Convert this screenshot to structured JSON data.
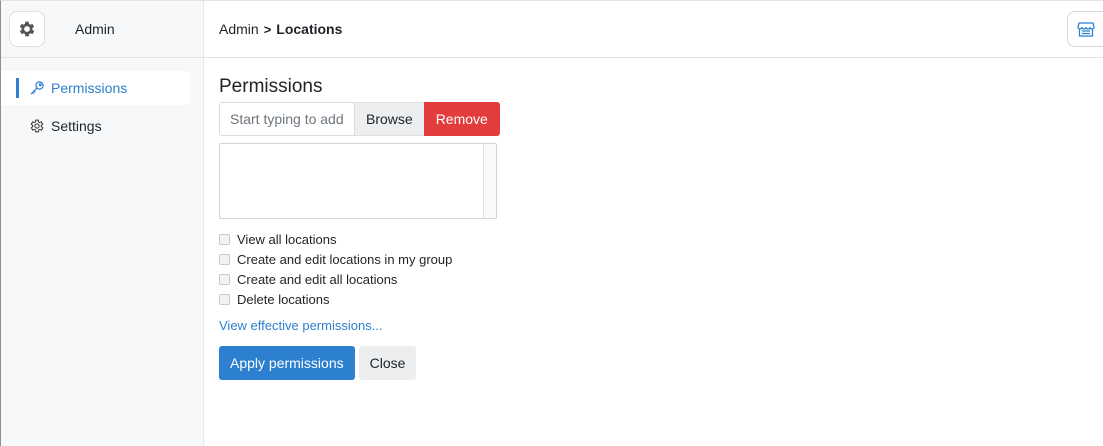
{
  "sidebar": {
    "title": "Admin",
    "logo_icon": "gear-icon",
    "items": [
      {
        "label": "Permissions",
        "icon": "key-icon",
        "active": true
      },
      {
        "label": "Settings",
        "icon": "gear-icon",
        "active": false
      }
    ]
  },
  "breadcrumb": {
    "parent": "Admin",
    "separator": ">",
    "current": "Locations"
  },
  "topbar": {
    "store_icon": "store-icon"
  },
  "permissions": {
    "title": "Permissions",
    "input_placeholder": "Start typing to add",
    "browse_label": "Browse",
    "remove_label": "Remove",
    "checkboxes": [
      {
        "label": "View all locations",
        "checked": false
      },
      {
        "label": "Create and edit locations in my group",
        "checked": false
      },
      {
        "label": "Create and edit all locations",
        "checked": false
      },
      {
        "label": "Delete locations",
        "checked": false
      }
    ],
    "effective_link": "View effective permissions...",
    "apply_label": "Apply permissions",
    "close_label": "Close"
  },
  "colors": {
    "accent": "#2d7fd0",
    "danger": "#e23c3c",
    "sidebar_bg": "#f7f8f9"
  }
}
